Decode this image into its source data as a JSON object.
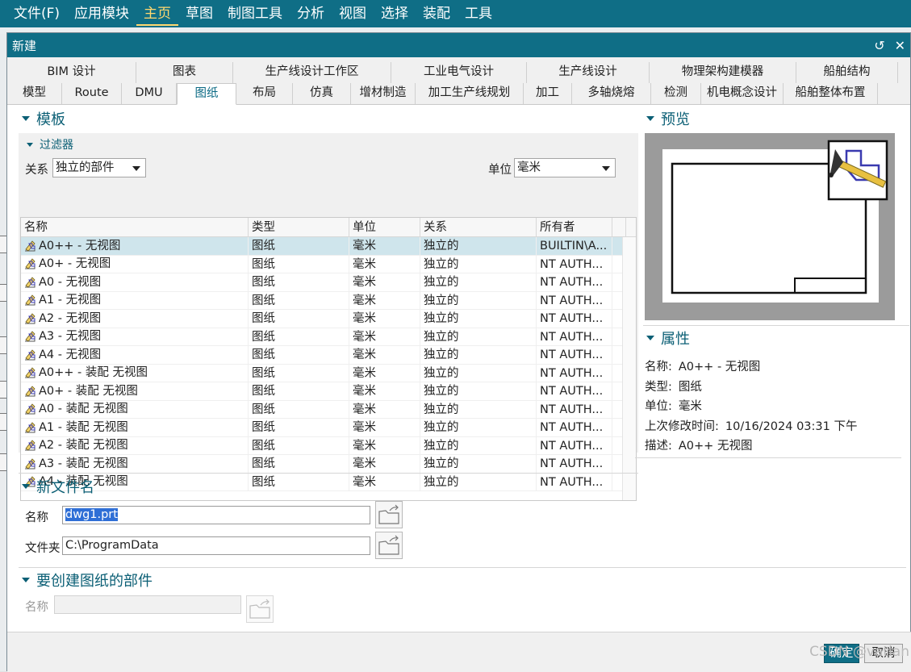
{
  "menubar": {
    "items": [
      "文件(F)",
      "应用模块",
      "主页",
      "草图",
      "制图工具",
      "分析",
      "视图",
      "选择",
      "装配",
      "工具"
    ],
    "active_index": 2
  },
  "dialog": {
    "title": "新建",
    "reset_glyph": "↺",
    "close_glyph": "✕"
  },
  "tabs": {
    "row1": [
      "BIM 设计",
      "图表",
      "生产线设计工作区",
      "工业电气设计",
      "生产线设计",
      "物理架构建模器",
      "船舶结构"
    ],
    "row2": [
      "模型",
      "Route",
      "DMU",
      "图纸",
      "布局",
      "仿真",
      "增材制造",
      "加工生产线规划",
      "加工",
      "多轴烧熔",
      "检测",
      "机电概念设计",
      "船舶整体布置"
    ],
    "selected_row2_index": 3
  },
  "template_section": {
    "title": "模板",
    "filter": {
      "title": "过滤器",
      "relation_label": "关系",
      "relation_value": "独立的部件",
      "unit_label": "单位",
      "unit_value": "毫米"
    },
    "columns": [
      "名称",
      "类型",
      "单位",
      "关系",
      "所有者"
    ],
    "rows": [
      [
        "A0++ - 无视图",
        "图纸",
        "毫米",
        "独立的",
        "BUILTIN\\A..."
      ],
      [
        "A0+ - 无视图",
        "图纸",
        "毫米",
        "独立的",
        "NT AUTH..."
      ],
      [
        "A0 - 无视图",
        "图纸",
        "毫米",
        "独立的",
        "NT AUTH..."
      ],
      [
        "A1 - 无视图",
        "图纸",
        "毫米",
        "独立的",
        "NT AUTH..."
      ],
      [
        "A2 - 无视图",
        "图纸",
        "毫米",
        "独立的",
        "NT AUTH..."
      ],
      [
        "A3 - 无视图",
        "图纸",
        "毫米",
        "独立的",
        "NT AUTH..."
      ],
      [
        "A4 - 无视图",
        "图纸",
        "毫米",
        "独立的",
        "NT AUTH..."
      ],
      [
        "A0++ - 装配 无视图",
        "图纸",
        "毫米",
        "独立的",
        "NT AUTH..."
      ],
      [
        "A0+ - 装配 无视图",
        "图纸",
        "毫米",
        "独立的",
        "NT AUTH..."
      ],
      [
        "A0 - 装配 无视图",
        "图纸",
        "毫米",
        "独立的",
        "NT AUTH..."
      ],
      [
        "A1 - 装配 无视图",
        "图纸",
        "毫米",
        "独立的",
        "NT AUTH..."
      ],
      [
        "A2 - 装配 无视图",
        "图纸",
        "毫米",
        "独立的",
        "NT AUTH..."
      ],
      [
        "A3 - 装配 无视图",
        "图纸",
        "毫米",
        "独立的",
        "NT AUTH..."
      ],
      [
        "A4 - 装配 无视图",
        "图纸",
        "毫米",
        "独立的",
        "NT AUTH..."
      ]
    ],
    "selected_row_index": 0
  },
  "new_file_section": {
    "title": "新文件名",
    "name_label": "名称",
    "name_value": "dwg1.prt",
    "folder_label": "文件夹",
    "folder_value": "C:\\ProgramData"
  },
  "part_section": {
    "title": "要创建图纸的部件",
    "name_label": "名称",
    "name_value": ""
  },
  "preview_section": {
    "title": "预览"
  },
  "properties_section": {
    "title": "属性",
    "items": [
      {
        "key": "名称:",
        "value": "A0++ - 无视图"
      },
      {
        "key": "类型:",
        "value": "图纸"
      },
      {
        "key": "单位:",
        "value": "毫米"
      },
      {
        "key": "上次修改时间:",
        "value": "10/16/2024 03:31 下午"
      },
      {
        "key": "描述:",
        "value": "A0++ 无视图"
      }
    ]
  },
  "footer": {
    "ok_label": "确定",
    "cancel_label": "取消"
  },
  "watermark": "CSDN @vatian",
  "colors": {
    "titlebar": "#0f6e86",
    "accent_text": "#0b5f75",
    "selected_row": "#cfe5ec",
    "active_menu": "#ffd870"
  }
}
